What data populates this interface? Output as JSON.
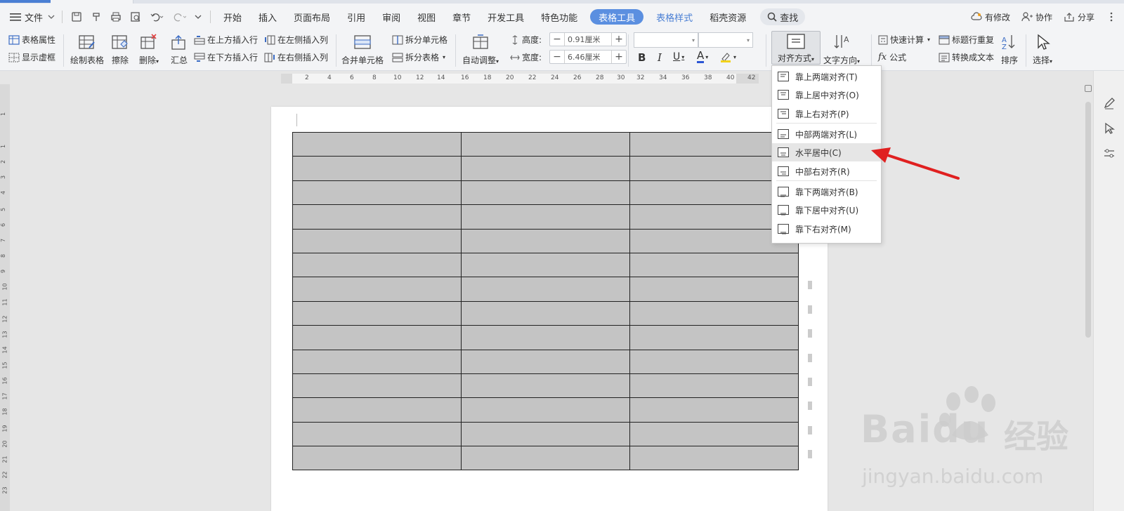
{
  "menubar": {
    "file_label": "文件",
    "tabs": [
      "开始",
      "插入",
      "页面布局",
      "引用",
      "审阅",
      "视图",
      "章节",
      "开发工具",
      "特色功能"
    ],
    "active_tab": "表格工具",
    "extra_tabs": [
      "表格样式",
      "稻壳资源"
    ],
    "search_label": "查找",
    "right_items": [
      "有修改",
      "协作",
      "分享"
    ]
  },
  "ribbon": {
    "table_props": "表格属性",
    "show_grid": "显示虚框",
    "draw_table": "绘制表格",
    "erase": "擦除",
    "delete": "删除",
    "summary": "汇总",
    "insert_row_above": "在上方插入行",
    "insert_row_below": "在下方插入行",
    "insert_col_left": "在左侧插入列",
    "insert_col_right": "在右侧插入列",
    "merge_cells": "合并单元格",
    "split_cells": "拆分单元格",
    "split_table": "拆分表格",
    "auto_fit": "自动调整",
    "height_label": "高度:",
    "height_value": "0.91厘米",
    "width_label": "宽度:",
    "width_value": "6.46厘米",
    "bold": "B",
    "italic": "I",
    "underline": "U",
    "font_color": "A",
    "align_mode": "对齐方式",
    "text_direction": "文字方向",
    "quick_calc": "快速计算",
    "formula": "公式",
    "header_repeat": "标题行重复",
    "convert_text": "转换成文本",
    "sort": "排序",
    "select": "选择"
  },
  "ruler": {
    "h_ticks": [
      "2",
      "4",
      "6",
      "8",
      "10",
      "12",
      "14",
      "16",
      "18",
      "20",
      "22",
      "24",
      "26",
      "28",
      "30",
      "32",
      "34",
      "36",
      "38",
      "40",
      "42"
    ],
    "v_ticks": [
      "1",
      "1",
      "2",
      "3",
      "4",
      "5",
      "6",
      "7",
      "8",
      "9",
      "10",
      "11",
      "12",
      "13",
      "14",
      "15",
      "16",
      "17",
      "18",
      "19",
      "20",
      "21",
      "22",
      "23"
    ]
  },
  "table": {
    "rows": 14,
    "cols": 3,
    "cell_color": "#c4c4c4"
  },
  "dropdown": {
    "items": [
      "靠上两端对齐(T)",
      "靠上居中对齐(O)",
      "靠上右对齐(P)",
      "中部两端对齐(L)",
      "水平居中(C)",
      "中部右对齐(R)",
      "靠下两端对齐(B)",
      "靠下居中对齐(U)",
      "靠下右对齐(M)"
    ],
    "highlighted_index": 4
  },
  "annotation": {
    "arrow_color": "#e02020"
  },
  "watermark": {
    "brand": "Baidu",
    "cn": "经验",
    "url": "jingyan.baidu.com"
  },
  "colors": {
    "accent": "#5b8fe0",
    "ribbon_bg": "#f3f4f6",
    "canvas_bg": "#e6e6e6"
  }
}
